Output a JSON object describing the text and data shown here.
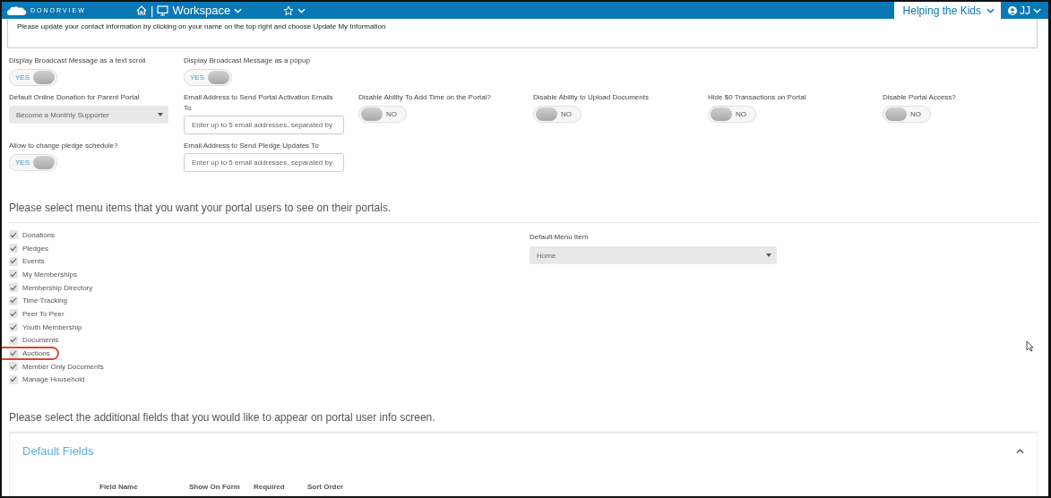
{
  "header": {
    "logo": "DONORVIEW",
    "separator": "|",
    "workspace": "Workspace",
    "organization": "Helping the Kids",
    "user": "JJ"
  },
  "broadcast_message": {
    "value": "Please update your contact information by clicking on your name on the top right and choose Update My Information"
  },
  "settings_rows": [
    [
      {
        "kind": "toggle",
        "label": "Display Broadcast Message as a text scroll",
        "on": true,
        "state_label": "YES"
      },
      {
        "kind": "toggle",
        "label": "Display Broadcast Message as a popup",
        "on": true,
        "state_label": "YES"
      }
    ],
    [
      {
        "kind": "select",
        "label": "Default Online Donation for Parent Portal",
        "value": "Become a Monthly Supporter"
      },
      {
        "kind": "email",
        "label": "Email Address to Send Portal Activation Emails To",
        "placeholder": "Enter up to 5 email addresses, separated by"
      },
      {
        "kind": "toggle",
        "label": "Disable Ability To Add Time on the Portal?",
        "on": false,
        "state_label": "NO"
      },
      {
        "kind": "toggle",
        "label": "Disable Ability to Upload Documents",
        "on": false,
        "state_label": "NO"
      },
      {
        "kind": "toggle",
        "label": "Hide $0 Transactions on Portal",
        "on": false,
        "state_label": "NO"
      },
      {
        "kind": "toggle",
        "label": "Disable Portal Access?",
        "on": false,
        "state_label": "NO"
      }
    ],
    [
      {
        "kind": "toggle",
        "label": "Allow to change pledge schedule?",
        "on": true,
        "state_label": "YES"
      },
      {
        "kind": "email",
        "label": "Email Address to Send Pledge Updates To",
        "placeholder": "Enter up to 5 email addresses, separated by"
      }
    ]
  ],
  "menu_section": {
    "heading": "Please select menu items that you want your portal users to see on their portals.",
    "items": [
      {
        "label": "Donations",
        "checked": true,
        "highlighted": false
      },
      {
        "label": "Pledges",
        "checked": true,
        "highlighted": false
      },
      {
        "label": "Events",
        "checked": true,
        "highlighted": false
      },
      {
        "label": "My Memberships",
        "checked": true,
        "highlighted": false
      },
      {
        "label": "Membership Directory",
        "checked": true,
        "highlighted": false
      },
      {
        "label": "Time Tracking",
        "checked": true,
        "highlighted": false
      },
      {
        "label": "Peer To Peer",
        "checked": true,
        "highlighted": false
      },
      {
        "label": "Youth Membership",
        "checked": true,
        "highlighted": false
      },
      {
        "label": "Documents",
        "checked": true,
        "highlighted": false
      },
      {
        "label": "Auctions",
        "checked": true,
        "highlighted": true
      },
      {
        "label": "Member Only Documents",
        "checked": true,
        "highlighted": false
      },
      {
        "label": "Manage Household",
        "checked": true,
        "highlighted": false
      }
    ],
    "default_menu_item": {
      "label": "Default Menu Item",
      "value": "Home"
    }
  },
  "fields_section": {
    "heading": "Please select the additional fields that you would like to appear on portal user info screen.",
    "panel_title": "Default Fields",
    "columns": [
      "Field Name",
      "Show On Form",
      "Required",
      "Sort Order"
    ]
  }
}
